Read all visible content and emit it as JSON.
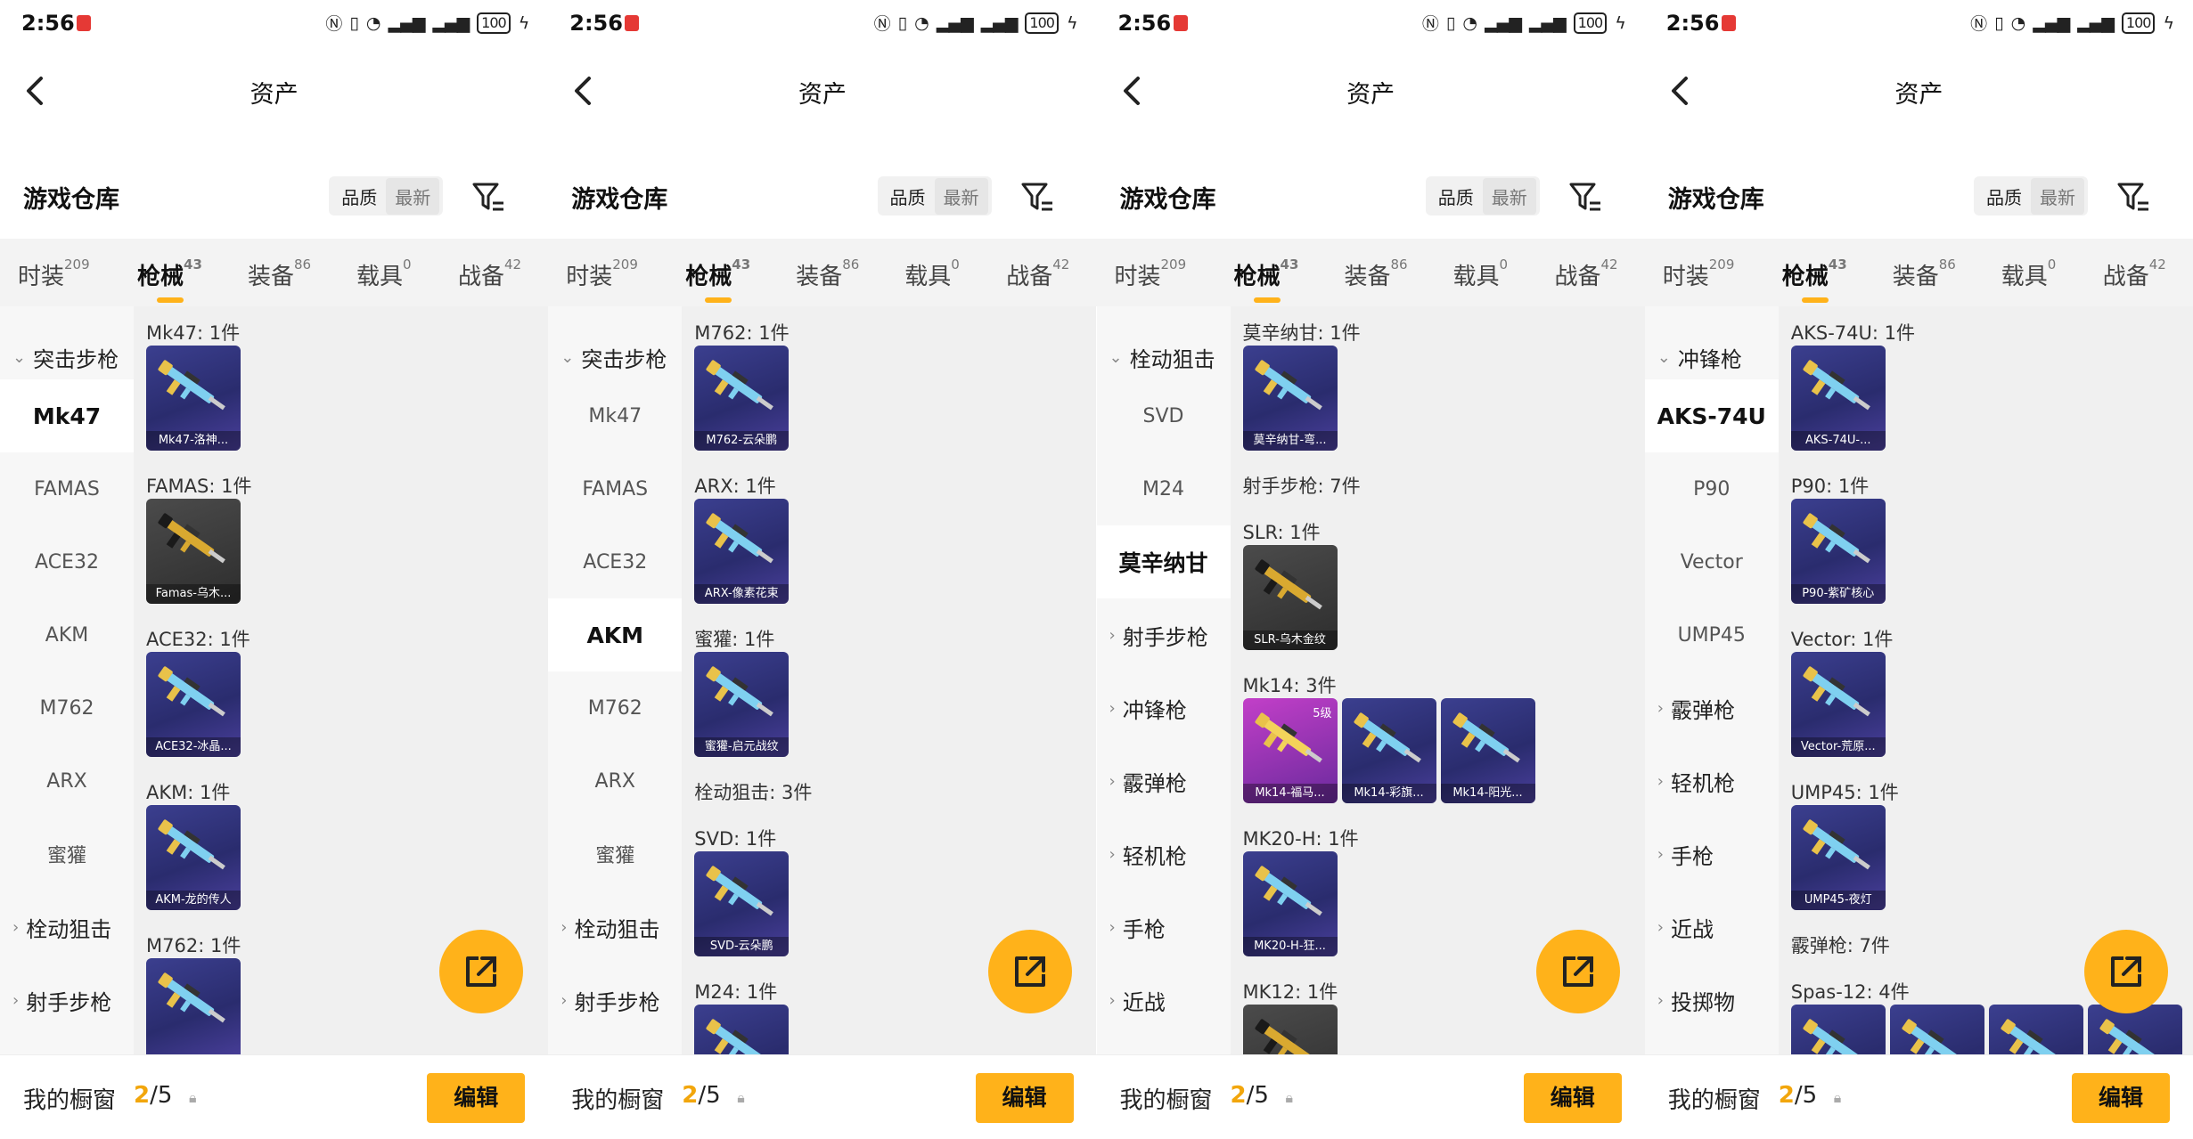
{
  "status": {
    "time": "2:56",
    "battery": "100"
  },
  "header": {
    "title": "资产"
  },
  "warehouse": {
    "title": "游戏仓库",
    "sort_quality": "品质",
    "sort_newest": "最新"
  },
  "tabs": [
    {
      "label": "时装",
      "count": "209"
    },
    {
      "label": "枪械",
      "count": "43"
    },
    {
      "label": "装备",
      "count": "86"
    },
    {
      "label": "载具",
      "count": "0"
    },
    {
      "label": "战备",
      "count": "42"
    }
  ],
  "bottom": {
    "label": "我的橱窗",
    "current": "2",
    "total": "/5",
    "edit": "编辑"
  },
  "screens": [
    {
      "side": [
        {
          "label": "突击步枪",
          "kind": "group-open"
        },
        {
          "label": "Mk47",
          "kind": "selected"
        },
        {
          "label": "FAMAS",
          "kind": "item"
        },
        {
          "label": "ACE32",
          "kind": "item"
        },
        {
          "label": "AKM",
          "kind": "item"
        },
        {
          "label": "M762",
          "kind": "item"
        },
        {
          "label": "ARX",
          "kind": "item"
        },
        {
          "label": "蜜獾",
          "kind": "item"
        },
        {
          "label": "栓动狙击",
          "kind": "group"
        },
        {
          "label": "射手步枪",
          "kind": "group"
        }
      ],
      "rows": [
        {
          "label": "Mk47: 1件",
          "cards": [
            {
              "cap": "Mk47-洛神...",
              "style": "blue"
            }
          ]
        },
        {
          "label": "FAMAS: 1件",
          "cards": [
            {
              "cap": "Famas-乌木...",
              "style": "gold"
            }
          ]
        },
        {
          "label": "ACE32: 1件",
          "cards": [
            {
              "cap": "ACE32-冰晶...",
              "style": "blue"
            }
          ]
        },
        {
          "label": "AKM: 1件",
          "cards": [
            {
              "cap": "AKM-龙的传人",
              "style": "blue"
            }
          ]
        },
        {
          "label": "M762: 1件",
          "cards": [
            {
              "cap": "",
              "style": "blue"
            }
          ]
        }
      ]
    },
    {
      "side": [
        {
          "label": "突击步枪",
          "kind": "group-open"
        },
        {
          "label": "Mk47",
          "kind": "item"
        },
        {
          "label": "FAMAS",
          "kind": "item"
        },
        {
          "label": "ACE32",
          "kind": "item"
        },
        {
          "label": "AKM",
          "kind": "selected"
        },
        {
          "label": "M762",
          "kind": "item"
        },
        {
          "label": "ARX",
          "kind": "item"
        },
        {
          "label": "蜜獾",
          "kind": "item"
        },
        {
          "label": "栓动狙击",
          "kind": "group"
        },
        {
          "label": "射手步枪",
          "kind": "group"
        }
      ],
      "rows": [
        {
          "label": "M762: 1件",
          "cards": [
            {
              "cap": "M762-云朵鹏",
              "style": "blue"
            }
          ]
        },
        {
          "label": "ARX: 1件",
          "cards": [
            {
              "cap": "ARX-像素花束",
              "style": "blue"
            }
          ]
        },
        {
          "label": "蜜獾: 1件",
          "cards": [
            {
              "cap": "蜜獾-启元战纹",
              "style": "blue"
            }
          ]
        },
        {
          "label": "栓动狙击: 3件",
          "cards": []
        },
        {
          "label": "SVD: 1件",
          "cards": [
            {
              "cap": "SVD-云朵鹏",
              "style": "blue"
            }
          ]
        },
        {
          "label": "M24: 1件",
          "cards": [
            {
              "cap": "",
              "style": "blue"
            }
          ]
        }
      ]
    },
    {
      "side": [
        {
          "label": "栓动狙击",
          "kind": "group-open"
        },
        {
          "label": "SVD",
          "kind": "item"
        },
        {
          "label": "M24",
          "kind": "item"
        },
        {
          "label": "莫辛纳甘",
          "kind": "selected"
        },
        {
          "label": "射手步枪",
          "kind": "group"
        },
        {
          "label": "冲锋枪",
          "kind": "group"
        },
        {
          "label": "霰弹枪",
          "kind": "group"
        },
        {
          "label": "轻机枪",
          "kind": "group"
        },
        {
          "label": "手枪",
          "kind": "group"
        },
        {
          "label": "近战",
          "kind": "group"
        }
      ],
      "rows": [
        {
          "label": "莫辛纳甘: 1件",
          "cards": [
            {
              "cap": "莫辛纳甘-弯...",
              "style": "blue"
            }
          ]
        },
        {
          "label": "射手步枪: 7件",
          "cards": []
        },
        {
          "label": "SLR: 1件",
          "cards": [
            {
              "cap": "SLR-乌木金纹",
              "style": "gold"
            }
          ]
        },
        {
          "label": "Mk14: 3件",
          "cards": [
            {
              "cap": "Mk14-福马...",
              "style": "pink",
              "level": "5级"
            },
            {
              "cap": "Mk14-彩旗...",
              "style": "blue"
            },
            {
              "cap": "Mk14-阳光...",
              "style": "blue"
            }
          ]
        },
        {
          "label": "MK20-H: 1件",
          "cards": [
            {
              "cap": "MK20-H-狂...",
              "style": "blue"
            }
          ]
        },
        {
          "label": "MK12: 1件",
          "cards": [
            {
              "cap": "",
              "style": "gold"
            }
          ]
        }
      ]
    },
    {
      "side": [
        {
          "label": "冲锋枪",
          "kind": "group-open"
        },
        {
          "label": "AKS-74U",
          "kind": "selected"
        },
        {
          "label": "P90",
          "kind": "item"
        },
        {
          "label": "Vector",
          "kind": "item"
        },
        {
          "label": "UMP45",
          "kind": "item"
        },
        {
          "label": "霰弹枪",
          "kind": "group"
        },
        {
          "label": "轻机枪",
          "kind": "group"
        },
        {
          "label": "手枪",
          "kind": "group"
        },
        {
          "label": "近战",
          "kind": "group"
        },
        {
          "label": "投掷物",
          "kind": "group"
        }
      ],
      "rows": [
        {
          "label": "AKS-74U: 1件",
          "cards": [
            {
              "cap": "AKS-74U-...",
              "style": "blue"
            }
          ]
        },
        {
          "label": "P90: 1件",
          "cards": [
            {
              "cap": "P90-紫矿核心",
              "style": "blue"
            }
          ]
        },
        {
          "label": "Vector: 1件",
          "cards": [
            {
              "cap": "Vector-荒原...",
              "style": "blue"
            }
          ]
        },
        {
          "label": "UMP45: 1件",
          "cards": [
            {
              "cap": "UMP45-夜灯",
              "style": "blue"
            }
          ]
        },
        {
          "label": "霰弹枪: 7件",
          "cards": []
        },
        {
          "label": "Spas-12: 4件",
          "cards": [
            {
              "cap": "",
              "style": "blue"
            },
            {
              "cap": "",
              "style": "blue"
            },
            {
              "cap": "",
              "style": "blue"
            },
            {
              "cap": "",
              "style": "blue"
            }
          ]
        }
      ]
    }
  ]
}
